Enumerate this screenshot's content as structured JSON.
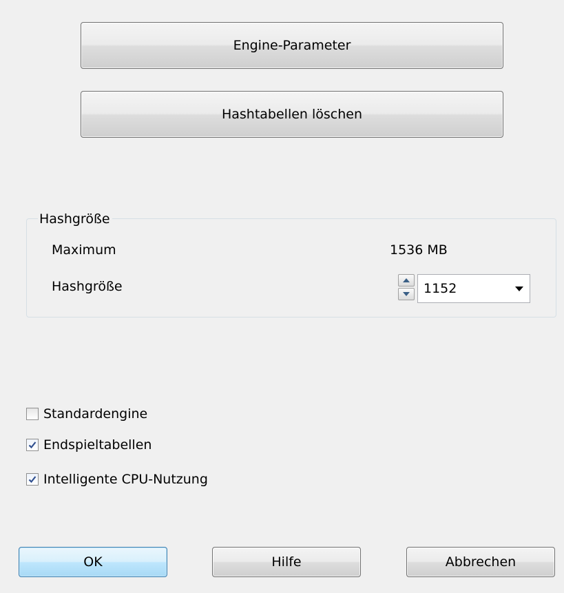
{
  "buttons": {
    "engine_params": "Engine-Parameter",
    "clear_hash": "Hashtabellen löschen",
    "ok": "OK",
    "help": "Hilfe",
    "cancel": "Abbrechen"
  },
  "hash_group": {
    "title": "Hashgröße",
    "maximum_label": "Maximum",
    "maximum_value": "1536 MB",
    "hashsize_label": "Hashgröße",
    "hashsize_value": "1152"
  },
  "checkboxes": [
    {
      "label": "Standardengine",
      "checked": false
    },
    {
      "label": "Endspieltabellen",
      "checked": true
    },
    {
      "label": "Intelligente CPU-Nutzung",
      "checked": true
    }
  ],
  "icons": {
    "spin_up": "spin-up-arrow-icon",
    "spin_down": "spin-down-arrow-icon",
    "dropdown": "chevron-down-icon",
    "check": "checkmark-icon"
  },
  "colors": {
    "window_bg": "#f0f0f0",
    "default_button_border": "#3c7fb1",
    "checkmark": "#2f4f8f"
  }
}
